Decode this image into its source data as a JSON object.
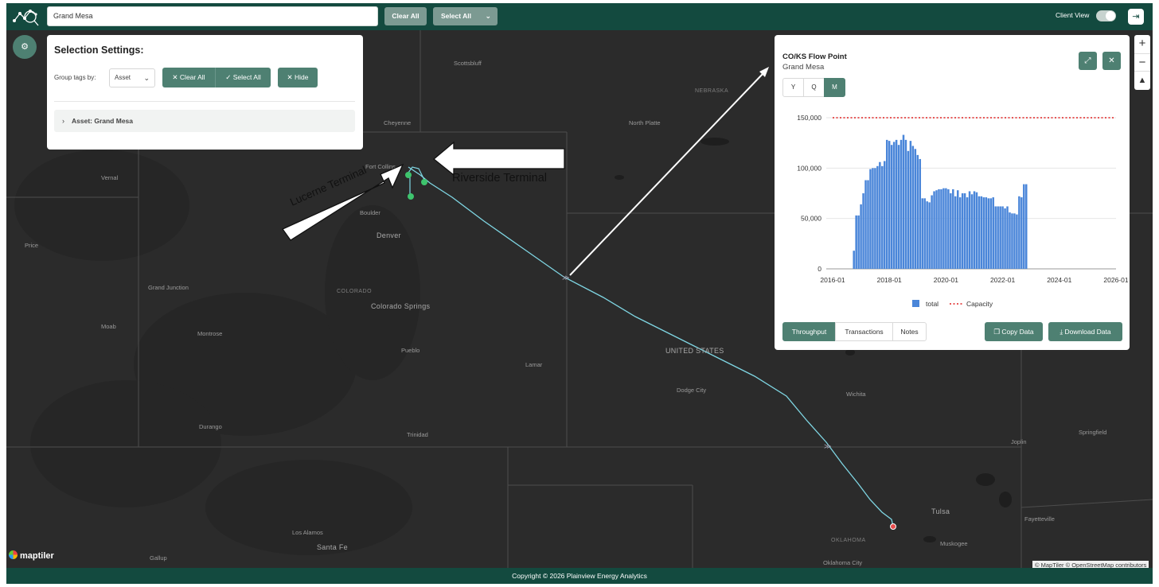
{
  "topbar": {
    "search_value": "Grand Mesa",
    "clear_all": "Clear All",
    "select_all": "Select All",
    "client_view": "Client View",
    "client_view_on": true
  },
  "map": {
    "places": {
      "scottsbluff": "Scottsbluff",
      "nebraska": "NEBRASKA",
      "cheyenne": "Cheyenne",
      "north_platte": "North Platte",
      "fort_collins": "Fort Collins",
      "vernal": "Vernal",
      "boulder": "Boulder",
      "denver": "Denver",
      "price": "Price",
      "grand_junction": "Grand Junction",
      "colorado": "COLORADO",
      "colorado_springs": "Colorado Springs",
      "moab": "Moab",
      "montrose": "Montrose",
      "pueblo": "Pueblo",
      "united_states": "UNITED STATES",
      "lamar": "Lamar",
      "dodge_city": "Dodge City",
      "wichita": "Wichita",
      "durango": "Durango",
      "trinidad": "Trinidad",
      "joplin": "Joplin",
      "springfield": "Springfield",
      "tulsa": "Tulsa",
      "fayetteville": "Fayetteville",
      "los_alamos": "Los Alamos",
      "santa_fe": "Santa Fe",
      "oklahoma": "OKLAHOMA",
      "muskogee": "Muskogee",
      "gallup": "Gallup",
      "oklahoma_city": "Oklahoma City"
    },
    "maptiler_logo": "maptiler",
    "attribution": "© MapTiler © OpenStreetMap contributors"
  },
  "annotations": {
    "lucerne": "Lucerne Terminal",
    "riverside": "Riverside Terminal"
  },
  "selection": {
    "title": "Selection Settings:",
    "group_label": "Group tags by:",
    "group_value": "Asset",
    "clear_all": "Clear All",
    "select_all": "Select All",
    "hide": "Hide",
    "asset_row": "Asset: Grand Mesa"
  },
  "panel": {
    "title": "CO/KS Flow Point",
    "subtitle": "Grand Mesa",
    "periods": [
      "Y",
      "Q",
      "M"
    ],
    "active_period": "M",
    "tabs": [
      "Throughput",
      "Transactions",
      "Notes"
    ],
    "active_tab": "Throughput",
    "copy_data": "Copy Data",
    "download_data": "Download Data"
  },
  "footer": {
    "copyright": "Copyright © 2026 Plainview Energy Analytics"
  },
  "colors": {
    "brand": "#134a3f",
    "accent": "#4e8072",
    "pipeline": "#7fd6e3",
    "terminal": "#3ec46d",
    "bar": "#4a86d9",
    "capacity": "#e02020"
  },
  "icons": {
    "logo": "network-logo-icon",
    "settings": "gear-icon",
    "logout": "logout-icon",
    "expand": "expand-icon",
    "close": "close-icon",
    "copy": "copy-icon",
    "download": "download-icon",
    "zoom_in": "plus-icon",
    "zoom_out": "minus-icon",
    "compass": "compass-icon"
  },
  "chart_data": {
    "type": "bar",
    "x_start": "2016-01",
    "x_end": "2026-01",
    "x_ticks": [
      "2016-01",
      "2018-01",
      "2020-01",
      "2022-01",
      "2024-01",
      "2026-01"
    ],
    "y_ticks": [
      "0",
      "50,000",
      "100,000",
      "150,000"
    ],
    "ylim": [
      0,
      150000
    ],
    "legend_position": "bottom",
    "grid": "horizontal",
    "series": [
      {
        "name": "total",
        "kind": "bar",
        "start": "2016-10",
        "values": [
          18000,
          53000,
          53000,
          64000,
          75000,
          88000,
          88000,
          99000,
          100000,
          100000,
          102000,
          106000,
          102000,
          107000,
          128000,
          127000,
          123000,
          126000,
          128000,
          123000,
          128000,
          133000,
          128000,
          117000,
          127000,
          122000,
          119000,
          113000,
          109000,
          70000,
          70000,
          67000,
          66000,
          73000,
          77000,
          78000,
          79000,
          79000,
          80000,
          80000,
          79000,
          75000,
          79000,
          72000,
          78000,
          71000,
          75000,
          75000,
          71000,
          77000,
          74000,
          77000,
          76000,
          72000,
          72000,
          71000,
          71000,
          70000,
          70000,
          71000,
          62000,
          62000,
          62000,
          62000,
          60000,
          62000,
          56000,
          55000,
          55000,
          54000,
          72000,
          71000,
          84000,
          84000
        ]
      },
      {
        "name": "Capacity",
        "kind": "line",
        "values": [
          150000
        ]
      }
    ]
  }
}
